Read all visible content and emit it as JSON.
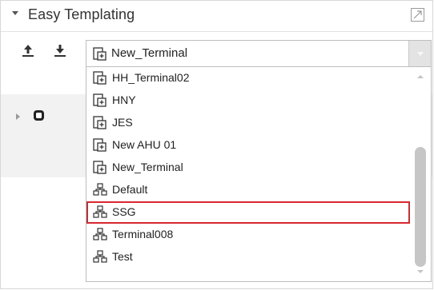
{
  "header": {
    "title": "Easy Templating",
    "collapse_icon": "chevron-down-icon",
    "expand_icon": "expand-icon"
  },
  "toolbar": {
    "upload_icon": "upload-icon",
    "download_icon": "download-icon"
  },
  "combo": {
    "value": "New_Terminal",
    "value_icon": "terminal-template-icon"
  },
  "dropdown": {
    "items": [
      {
        "label": "HH_Terminal02",
        "icon": "terminal-template-icon"
      },
      {
        "label": "HNY",
        "icon": "terminal-template-icon"
      },
      {
        "label": "JES",
        "icon": "terminal-template-icon"
      },
      {
        "label": "New AHU 01",
        "icon": "terminal-template-icon"
      },
      {
        "label": "New_Terminal",
        "icon": "terminal-template-icon"
      },
      {
        "label": "Default",
        "icon": "network-group-icon"
      },
      {
        "label": "SSG",
        "icon": "network-group-icon",
        "highlighted": true
      },
      {
        "label": "Terminal008",
        "icon": "network-group-icon"
      },
      {
        "label": "Test",
        "icon": "network-group-icon"
      }
    ]
  },
  "colors": {
    "highlight_border": "#d8272e",
    "scrollbar_thumb": "#c6c6c6",
    "combo_button": "#e3e3e3"
  }
}
